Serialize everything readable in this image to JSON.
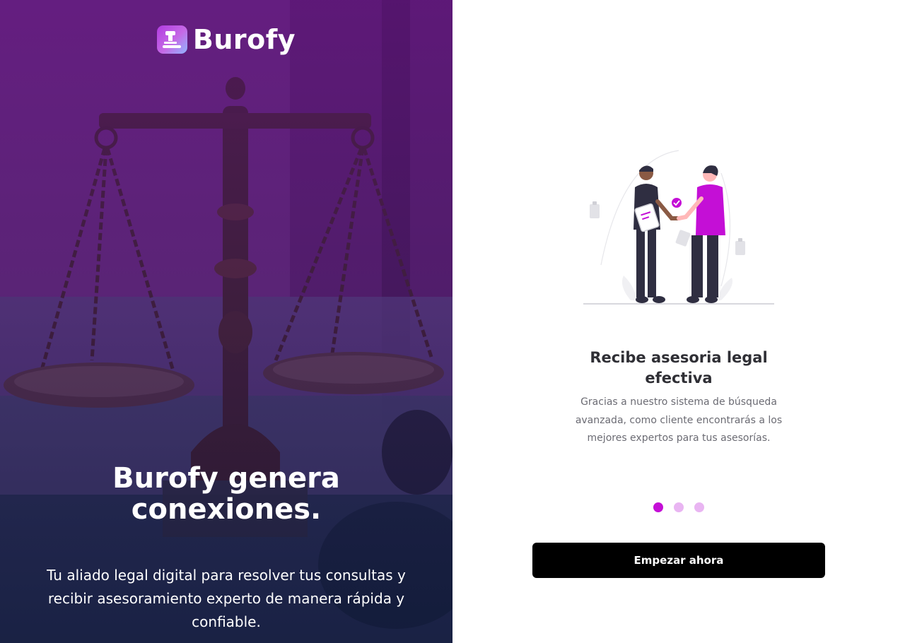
{
  "brand": {
    "name": "Burofy",
    "logo_icon": "gavel-icon"
  },
  "hero": {
    "title_line1": "Burofy genera",
    "title_line2": "conexiones.",
    "subtitle": "Tu aliado legal digital para resolver tus consultas y recibir asesoramiento experto de manera rápida y confiable.",
    "background_image": "scales-of-justice"
  },
  "onboarding": {
    "illustration": "handshake-illustration",
    "title_line1": "Recibe asesoria legal",
    "title_line2": "efectiva",
    "description": "Gracias a nuestro sistema de búsqueda avanzada, como cliente encontrarás a los mejores expertos para tus asesorías.",
    "dots": [
      {
        "active": true
      },
      {
        "active": false
      },
      {
        "active": false
      }
    ],
    "cta_label": "Empezar ahora"
  },
  "colors": {
    "accent": "#c40fd6",
    "accent_light": "#e9b5f2",
    "button_bg": "#000000",
    "hero_purple": "#5e1a78"
  }
}
